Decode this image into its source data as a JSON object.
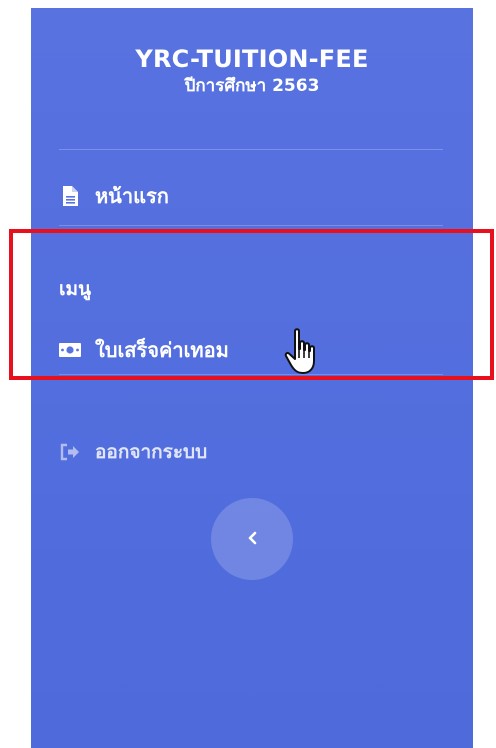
{
  "sidebar": {
    "brand": {
      "title": "YRC-TUITION-FEE",
      "subtitle": "ปีการศึกษา 2563"
    },
    "home": {
      "label": "หน้าแรก",
      "icon": "file-icon"
    },
    "menu_heading": "เมนู",
    "receipt": {
      "label": "ใบเสร็จค่าเทอม",
      "icon": "money-bill-icon"
    },
    "logout": {
      "label": "ออกจากระบบ",
      "icon": "sign-out-icon"
    },
    "toggle": {
      "icon": "chevron-left-icon"
    }
  },
  "colors": {
    "sidebar_bg": "#5872e0",
    "highlight": "#e8101d"
  }
}
